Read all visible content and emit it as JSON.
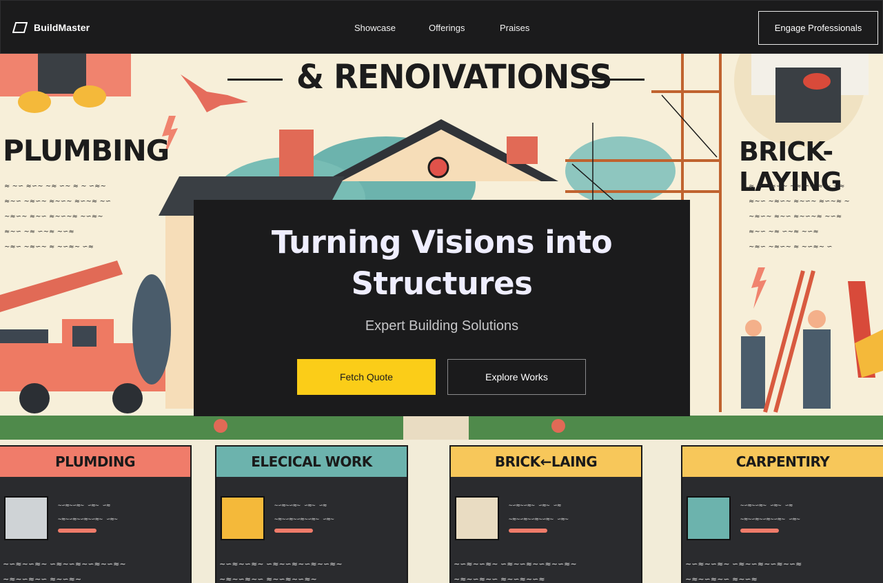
{
  "nav": {
    "brand": "BuildMaster",
    "links": [
      "Showcase",
      "Offerings",
      "Praises"
    ],
    "cta": "Engage Professionals"
  },
  "hero": {
    "headline_line1": "Turning Visions into",
    "headline_line2": "Structures",
    "subheading": "Expert Building Solutions",
    "primary_button": "Fetch Quote",
    "secondary_button": "Explore Works"
  },
  "illustration": {
    "banner_title": "& RENOIVATIONSS",
    "left_title": "PLUMBING",
    "right_title": "BRICK-LAYING",
    "cards": [
      "PLUMDING",
      "ELECICAL WORK",
      "BRICK←LAING",
      "CARPENTIRY"
    ]
  },
  "colors": {
    "accent": "#fbcd18",
    "nav_bg": "#1b1b1c",
    "headline": "#efeeff"
  }
}
